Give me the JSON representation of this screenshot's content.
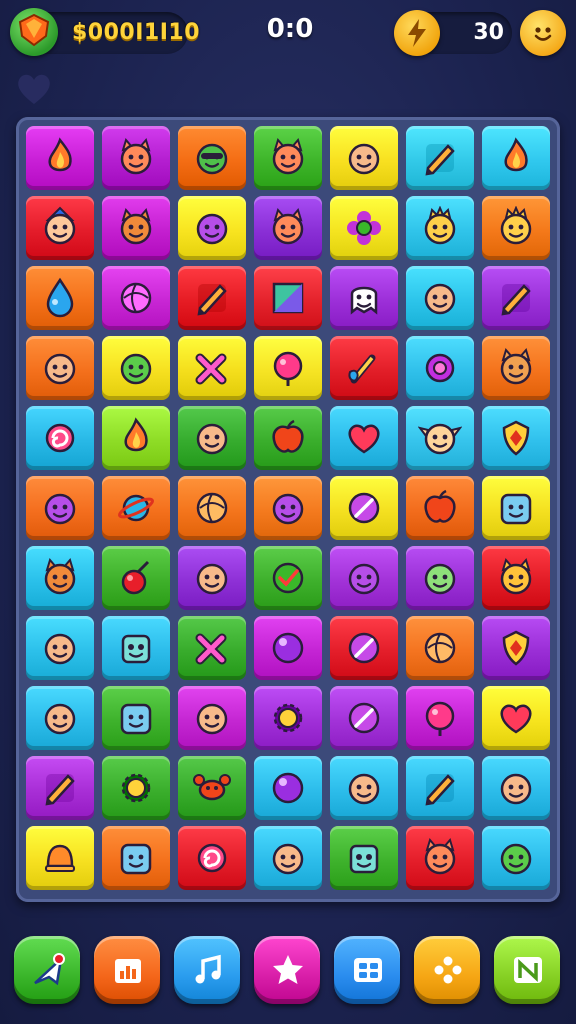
{
  "hud": {
    "coins": "$000I1I10",
    "score": "0:0",
    "moves": "30",
    "icons": [
      "gem-icon",
      "lightning-icon",
      "smiley-icon",
      "heart-icon"
    ]
  },
  "board": {
    "rows": [
      [
        {
          "c": "#c81fd6",
          "i": "flame"
        },
        {
          "c": "#b41ed0",
          "i": "cat"
        },
        {
          "c": "#f46d14",
          "i": "ninja"
        },
        {
          "c": "#3eb52a",
          "i": "cat"
        },
        {
          "c": "#f8e020",
          "i": "face"
        },
        {
          "c": "#32c9e8",
          "i": "pencil"
        },
        {
          "c": "#30c8ee",
          "i": "flame"
        }
      ],
      [
        {
          "c": "#e41c2a",
          "i": "wizard"
        },
        {
          "c": "#c41fd0",
          "i": "fox"
        },
        {
          "c": "#f8e420",
          "i": "blob"
        },
        {
          "c": "#8a2fd6",
          "i": "cat"
        },
        {
          "c": "#f4e420",
          "i": "flower"
        },
        {
          "c": "#30c4ea",
          "i": "crown"
        },
        {
          "c": "#f4791a",
          "i": "crown"
        }
      ],
      [
        {
          "c": "#f4711a",
          "i": "drop"
        },
        {
          "c": "#c826d4",
          "i": "ball"
        },
        {
          "c": "#e61c24",
          "i": "pencil"
        },
        {
          "c": "#e4232c",
          "i": "square"
        },
        {
          "c": "#9c2fd8",
          "i": "ghost"
        },
        {
          "c": "#2cc4ea",
          "i": "face"
        },
        {
          "c": "#9a31d8",
          "i": "pencil"
        }
      ],
      [
        {
          "c": "#f4701c",
          "i": "face"
        },
        {
          "c": "#f6e020",
          "i": "frog"
        },
        {
          "c": "#f4de1c",
          "i": "cross"
        },
        {
          "c": "#f6e424",
          "i": "bubble"
        },
        {
          "c": "#e21e28",
          "i": "brush"
        },
        {
          "c": "#30c0ea",
          "i": "ring"
        },
        {
          "c": "#f4731c",
          "i": "monster"
        }
      ],
      [
        {
          "c": "#28b8e6",
          "i": "swirl"
        },
        {
          "c": "#8edc26",
          "i": "flame"
        },
        {
          "c": "#36ac2e",
          "i": "face"
        },
        {
          "c": "#3aae2c",
          "i": "apple"
        },
        {
          "c": "#2cbcea",
          "i": "heart"
        },
        {
          "c": "#36c4ec",
          "i": "elf"
        },
        {
          "c": "#30c0ec",
          "i": "shield"
        }
      ],
      [
        {
          "c": "#f46e1e",
          "i": "blob"
        },
        {
          "c": "#f4701c",
          "i": "planet"
        },
        {
          "c": "#f4751c",
          "i": "ball"
        },
        {
          "c": "#f47a1e",
          "i": "blob"
        },
        {
          "c": "#f4e020",
          "i": "slash"
        },
        {
          "c": "#f26c1c",
          "i": "apple"
        },
        {
          "c": "#f4e020",
          "i": "cube"
        }
      ],
      [
        {
          "c": "#2ac0ea",
          "i": "fox"
        },
        {
          "c": "#3eb02a",
          "i": "cherry"
        },
        {
          "c": "#8e30d6",
          "i": "face"
        },
        {
          "c": "#3eb02c",
          "i": "check"
        },
        {
          "c": "#a232d8",
          "i": "blob"
        },
        {
          "c": "#9a30d6",
          "i": "alien"
        },
        {
          "c": "#e21c26",
          "i": "lion"
        }
      ],
      [
        {
          "c": "#2cc0ea",
          "i": "face"
        },
        {
          "c": "#2cbcea",
          "i": "robot"
        },
        {
          "c": "#38ac2c",
          "i": "cross"
        },
        {
          "c": "#c424d4",
          "i": "orb"
        },
        {
          "c": "#e41e2a",
          "i": "slash"
        },
        {
          "c": "#f47420",
          "i": "ball"
        },
        {
          "c": "#9a2ed6",
          "i": "shield"
        }
      ],
      [
        {
          "c": "#2cbcea",
          "i": "face"
        },
        {
          "c": "#3eb22c",
          "i": "cube"
        },
        {
          "c": "#c426d2",
          "i": "face"
        },
        {
          "c": "#a02fd8",
          "i": "gear"
        },
        {
          "c": "#a232d8",
          "i": "slash"
        },
        {
          "c": "#c424d4",
          "i": "bubble"
        },
        {
          "c": "#f6e41e",
          "i": "heart"
        }
      ],
      [
        {
          "c": "#a82ed6",
          "i": "pencil"
        },
        {
          "c": "#3aae2c",
          "i": "gear"
        },
        {
          "c": "#38ac2c",
          "i": "crab"
        },
        {
          "c": "#2cbcea",
          "i": "orb"
        },
        {
          "c": "#2cbcea",
          "i": "face"
        },
        {
          "c": "#2cbcea",
          "i": "pencil"
        },
        {
          "c": "#2cbcea",
          "i": "face"
        }
      ],
      [
        {
          "c": "#f6e020",
          "i": "bell"
        },
        {
          "c": "#f4711c",
          "i": "cube"
        },
        {
          "c": "#e41e2a",
          "i": "swirl"
        },
        {
          "c": "#2cbcea",
          "i": "face"
        },
        {
          "c": "#3eb22c",
          "i": "robot"
        },
        {
          "c": "#e41e2a",
          "i": "cat"
        },
        {
          "c": "#2cbcea",
          "i": "frog"
        }
      ]
    ]
  },
  "bottom_bar": [
    {
      "name": "send-button",
      "color": "#3ab52a",
      "icon": "send-icon"
    },
    {
      "name": "stats-button",
      "color": "#f4661a",
      "icon": "bar-chart-icon"
    },
    {
      "name": "music-button",
      "color": "#2a9cee",
      "icon": "music-icon"
    },
    {
      "name": "star-button",
      "color": "#d81ea8",
      "icon": "star-icon"
    },
    {
      "name": "menu-button",
      "color": "#2a8cee",
      "icon": "grid-icon"
    },
    {
      "name": "game-button",
      "color": "#f6a614",
      "icon": "gamepad-icon"
    },
    {
      "name": "map-button",
      "color": "#86d024",
      "icon": "map-icon"
    }
  ]
}
